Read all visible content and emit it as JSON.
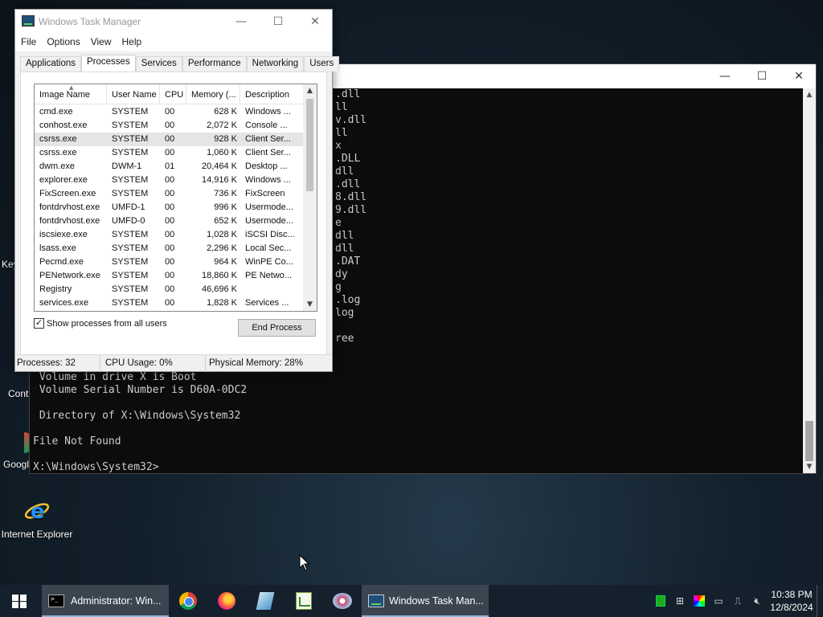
{
  "desktop": {
    "left_labels": [
      "Key",
      "Contr",
      "Google"
    ],
    "ie_label": "Internet Explorer"
  },
  "console": {
    "right_lines": [
      ".dll",
      "ll",
      "v.dll",
      "ll",
      "x",
      ".DLL",
      "dll",
      ".dll",
      "8.dll",
      "9.dll",
      "e",
      "dll",
      "dll",
      ".DAT",
      "dy",
      "g",
      ".log",
      "log",
      "",
      "ree"
    ],
    "bottom_lines": [
      " Volume in drive X is Boot",
      " Volume Serial Number is D60A-0DC2",
      "",
      " Directory of X:\\Windows\\System32",
      "",
      "File Not Found",
      "",
      "X:\\Windows\\System32>"
    ],
    "controls": {
      "minimize": "—",
      "maximize": "☐",
      "close": "✕"
    }
  },
  "taskmgr": {
    "title": "Windows Task Manager",
    "controls": {
      "minimize": "—",
      "maximize": "☐",
      "close": "✕"
    },
    "menu": [
      "File",
      "Options",
      "View",
      "Help"
    ],
    "tabs": [
      "Applications",
      "Processes",
      "Services",
      "Performance",
      "Networking",
      "Users"
    ],
    "active_tab": "Processes",
    "columns": [
      "Image Name",
      "User Name",
      "CPU",
      "Memory (...",
      "Description"
    ],
    "processes": [
      {
        "name": "cmd.exe",
        "user": "SYSTEM",
        "cpu": "00",
        "mem": "628 K",
        "desc": "Windows ..."
      },
      {
        "name": "conhost.exe",
        "user": "SYSTEM",
        "cpu": "00",
        "mem": "2,072 K",
        "desc": "Console ..."
      },
      {
        "name": "csrss.exe",
        "user": "SYSTEM",
        "cpu": "00",
        "mem": "928 K",
        "desc": "Client Ser..."
      },
      {
        "name": "csrss.exe",
        "user": "SYSTEM",
        "cpu": "00",
        "mem": "1,060 K",
        "desc": "Client Ser..."
      },
      {
        "name": "dwm.exe",
        "user": "DWM-1",
        "cpu": "01",
        "mem": "20,464 K",
        "desc": "Desktop ..."
      },
      {
        "name": "explorer.exe",
        "user": "SYSTEM",
        "cpu": "00",
        "mem": "14,916 K",
        "desc": "Windows ..."
      },
      {
        "name": "FixScreen.exe",
        "user": "SYSTEM",
        "cpu": "00",
        "mem": "736 K",
        "desc": "FixScreen"
      },
      {
        "name": "fontdrvhost.exe",
        "user": "UMFD-1",
        "cpu": "00",
        "mem": "996 K",
        "desc": "Usermode..."
      },
      {
        "name": "fontdrvhost.exe",
        "user": "UMFD-0",
        "cpu": "00",
        "mem": "652 K",
        "desc": "Usermode..."
      },
      {
        "name": "iscsiexe.exe",
        "user": "SYSTEM",
        "cpu": "00",
        "mem": "1,028 K",
        "desc": "iSCSI Disc..."
      },
      {
        "name": "lsass.exe",
        "user": "SYSTEM",
        "cpu": "00",
        "mem": "2,296 K",
        "desc": "Local Sec..."
      },
      {
        "name": "Pecmd.exe",
        "user": "SYSTEM",
        "cpu": "00",
        "mem": "964 K",
        "desc": "WinPE Co..."
      },
      {
        "name": "PENetwork.exe",
        "user": "SYSTEM",
        "cpu": "00",
        "mem": "18,860 K",
        "desc": "PE Netwo..."
      },
      {
        "name": "Registry",
        "user": "SYSTEM",
        "cpu": "00",
        "mem": "46,696 K",
        "desc": ""
      },
      {
        "name": "services.exe",
        "user": "SYSTEM",
        "cpu": "00",
        "mem": "1,828 K",
        "desc": "Services ..."
      }
    ],
    "selected_row": 2,
    "show_all_label": "Show processes from all users",
    "show_all_checked": "✓",
    "end_process": "End Process",
    "status": {
      "processes": "Processes: 32",
      "cpu": "CPU Usage: 0%",
      "memory": "Physical Memory: 28%"
    }
  },
  "taskbar": {
    "tasks": [
      {
        "label": "Administrator: Win..."
      },
      {
        "label": "Windows Task Man..."
      }
    ],
    "clock": {
      "time": "10:38 PM",
      "date": "12/8/2024"
    }
  }
}
